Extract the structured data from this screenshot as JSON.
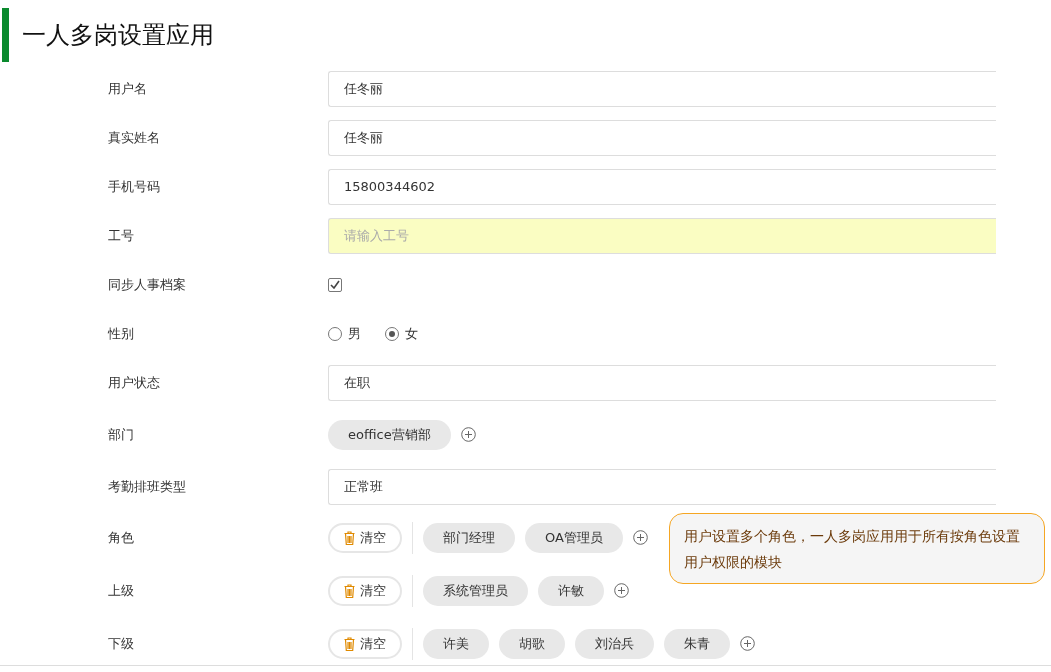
{
  "title": "一人多岗设置应用",
  "fields": [
    {
      "kind": "text",
      "label": "用户名",
      "value": "任冬丽"
    },
    {
      "kind": "text",
      "label": "真实姓名",
      "value": "任冬丽"
    },
    {
      "kind": "text",
      "label": "手机号码",
      "value": "15800344602"
    },
    {
      "kind": "text",
      "label": "工号",
      "placeholder": "请输入工号",
      "highlighted": true
    },
    {
      "kind": "checkbox",
      "label": "同步人事档案",
      "checked": true
    },
    {
      "kind": "radio",
      "label": "性别",
      "options": [
        {
          "label": "男",
          "selected": false
        },
        {
          "label": "女",
          "selected": true
        }
      ]
    },
    {
      "kind": "text",
      "label": "用户状态",
      "value": "在职"
    },
    {
      "kind": "tags",
      "label": "部门",
      "tags": [
        "eoffice营销部"
      ]
    },
    {
      "kind": "text",
      "label": "考勤排班类型",
      "value": "正常班"
    },
    {
      "kind": "tags_clear",
      "label": "角色",
      "clear": "清空",
      "tags": [
        "部门经理",
        "OA管理员"
      ]
    },
    {
      "kind": "tags_clear",
      "label": "上级",
      "clear": "清空",
      "tags": [
        "系统管理员",
        "许敏"
      ]
    },
    {
      "kind": "tags_clear",
      "label": "下级",
      "clear": "清空",
      "tags": [
        "许美",
        "胡歌",
        "刘治兵",
        "朱青"
      ]
    }
  ],
  "tooltip": "用户设置多个角色，一人多岗应用用于所有按角色设置用户权限的模块"
}
